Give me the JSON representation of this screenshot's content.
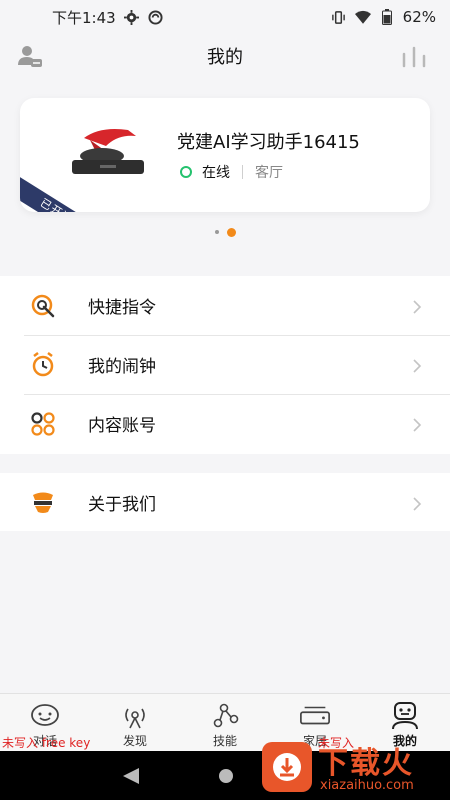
{
  "status_bar": {
    "time": "下午1:43",
    "battery": "62%",
    "icons": [
      "gear-icon",
      "sync-icon",
      "vibrate-icon",
      "wifi-icon",
      "battery-icon"
    ]
  },
  "header": {
    "title": "我的",
    "left_icon": "profile-settings-icon",
    "right_icon": "stats-bars-icon"
  },
  "device": {
    "name": "党建AI学习助手16415",
    "status": "在线",
    "room": "客厅",
    "ribbon": "已开通音乐",
    "status_color": "#25c26e"
  },
  "carousel": {
    "page_count": 2,
    "active_index": 1,
    "active_color": "#f28a1a"
  },
  "menu": {
    "group1": [
      {
        "label": "快捷指令",
        "icon": "shortcut-icon"
      },
      {
        "label": "我的闹钟",
        "icon": "alarm-clock-icon"
      },
      {
        "label": "内容账号",
        "icon": "content-account-icon"
      }
    ],
    "group2": [
      {
        "label": "关于我们",
        "icon": "about-us-icon"
      }
    ]
  },
  "tabs": [
    {
      "label": "对话",
      "icon": "chat-icon",
      "active": false
    },
    {
      "label": "发现",
      "icon": "discover-icon",
      "active": false
    },
    {
      "label": "技能",
      "icon": "skills-icon",
      "active": false
    },
    {
      "label": "家居",
      "icon": "home-device-icon",
      "active": false
    },
    {
      "label": "我的",
      "icon": "profile-icon",
      "active": true
    }
  ],
  "overlay": {
    "warning_left": "未写入 free key",
    "warning_right": "未写入"
  },
  "watermark": {
    "title": "下载火",
    "url": "xiazaihuo.com",
    "color": "#e8562a"
  },
  "accent_color": "#f28a1a"
}
